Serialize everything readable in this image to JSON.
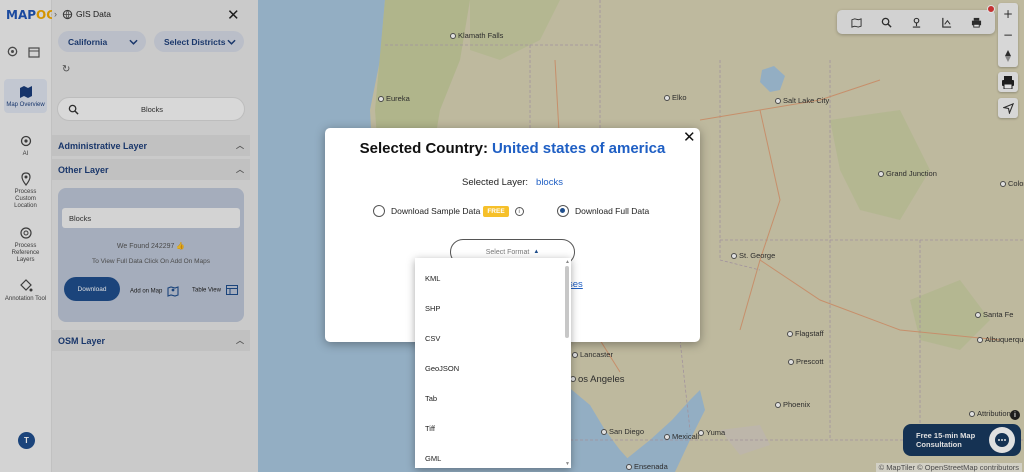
{
  "app": {
    "logo_text_1": "MAP",
    "logo_text_2": "OG",
    "panel_title": "GIS Data",
    "user_initial": "T"
  },
  "rail": {
    "items": [
      {
        "label": "Map Overview",
        "icon": "map-icon",
        "active": true
      },
      {
        "label": "AI",
        "icon": "gear-icon"
      },
      {
        "label": "Process Custom Location",
        "icon": "pin-icon"
      },
      {
        "label": "Process Reference Layers",
        "icon": "layers-icon"
      },
      {
        "label": "Annotation Tool",
        "icon": "paint-bucket-icon"
      }
    ]
  },
  "panel": {
    "state_select": "California",
    "district_select": "Select Districts",
    "search_value": "Blocks",
    "sections": {
      "administrative": "Administrative Layer",
      "other": "Other Layer",
      "osm": "OSM Layer"
    },
    "card": {
      "layer_name": "Blocks",
      "found_text": "We Found  242297",
      "view_text": "To View Full Data Click On Add On Maps",
      "download_label": "Download",
      "add_on_map_label": "Add on Map",
      "table_view_label": "Table View"
    }
  },
  "map": {
    "cities": [
      {
        "name": "Klamath Falls"
      },
      {
        "name": "Eureka"
      },
      {
        "name": "Elko"
      },
      {
        "name": "Salt Lake City"
      },
      {
        "name": "Grand Junction"
      },
      {
        "name": "Colora"
      },
      {
        "name": "St. George"
      },
      {
        "name": "Flagstaff"
      },
      {
        "name": "Santa Fe"
      },
      {
        "name": "Prescott"
      },
      {
        "name": "Albuquerque"
      },
      {
        "name": "Phoenix"
      },
      {
        "name": "Lancaster"
      },
      {
        "name": "os Angeles"
      },
      {
        "name": "San Diego"
      },
      {
        "name": "Mexicali"
      },
      {
        "name": "Yuma"
      },
      {
        "name": "Ensenada"
      }
    ],
    "attribution": "© MapTiler © OpenStreetMap contributors",
    "attribution_short": "Attribution",
    "colors": {
      "water": "#a8c6df",
      "land": "#d9d3b4",
      "green": "#c9cf9f"
    }
  },
  "consultation": {
    "line1": "Free 15-min Map",
    "line2": "Consultation"
  },
  "modal": {
    "title_prefix": "Selected Country:",
    "country": "United states of america",
    "layer_label": "Selected Layer:",
    "layer_value": "blocks",
    "sample_label": "Download Sample Data",
    "free_badge": "FREE",
    "full_label": "Download Full Data",
    "selected_option": "full",
    "format_placeholder": "Select Format",
    "partial_link": "ses"
  },
  "dropdown": {
    "options": [
      "KML",
      "SHP",
      "CSV",
      "GeoJSON",
      "Tab",
      "Tiff",
      "GML"
    ]
  }
}
